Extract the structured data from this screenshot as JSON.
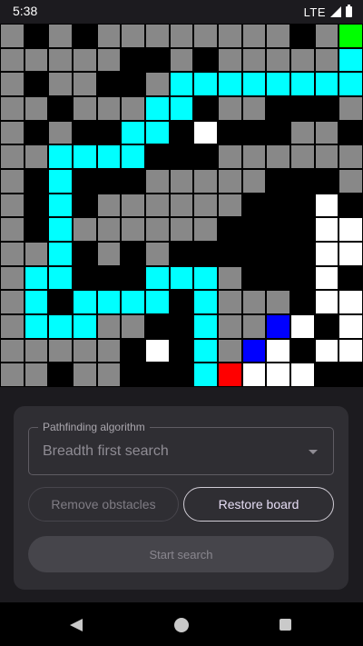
{
  "status_bar": {
    "time": "5:38",
    "network": "LTE"
  },
  "colors": {
    "wall": "#000000",
    "empty": "#888888",
    "visited": "#ffffff",
    "path": "#00ffff",
    "frontier": "#0000ff",
    "start": "#ff0000",
    "end": "#00ff00"
  },
  "grid": {
    "legend": {
      "B": "wall",
      "G": "empty",
      "W": "visited",
      "C": "path",
      "U": "frontier",
      "R": "start",
      "E": "end"
    },
    "rows": [
      "GBGBGGGGGGGGBGE",
      "GGGGGBBGBGGGGGC",
      "GBGGBBGCCCCCCCC",
      "GGBGGGCCBGGBBBG",
      "GBGBBCCBWBBBGGB",
      "GGCCCCBBBGGGGGG",
      "GBCBBBGGGGGBBBG",
      "GBCBGGGGGGBBBWB",
      "GBCGGGGGGBBBBWW",
      "GGCBGBGBBBBBBWW",
      "GCCBBBCCCGBBBWB",
      "GCBCCCCBCGGGBWW",
      "GCCCGGBBCGGUWBW",
      "GGGGGBWBCGUWBWW",
      "GGBGGBBBCRWWWBB"
    ]
  },
  "controls": {
    "algorithm_label": "Pathfinding algorithm",
    "algorithm_value": "Breadth first search",
    "remove_obstacles_label": "Remove obstacles",
    "restore_board_label": "Restore board",
    "start_search_label": "Start search"
  }
}
